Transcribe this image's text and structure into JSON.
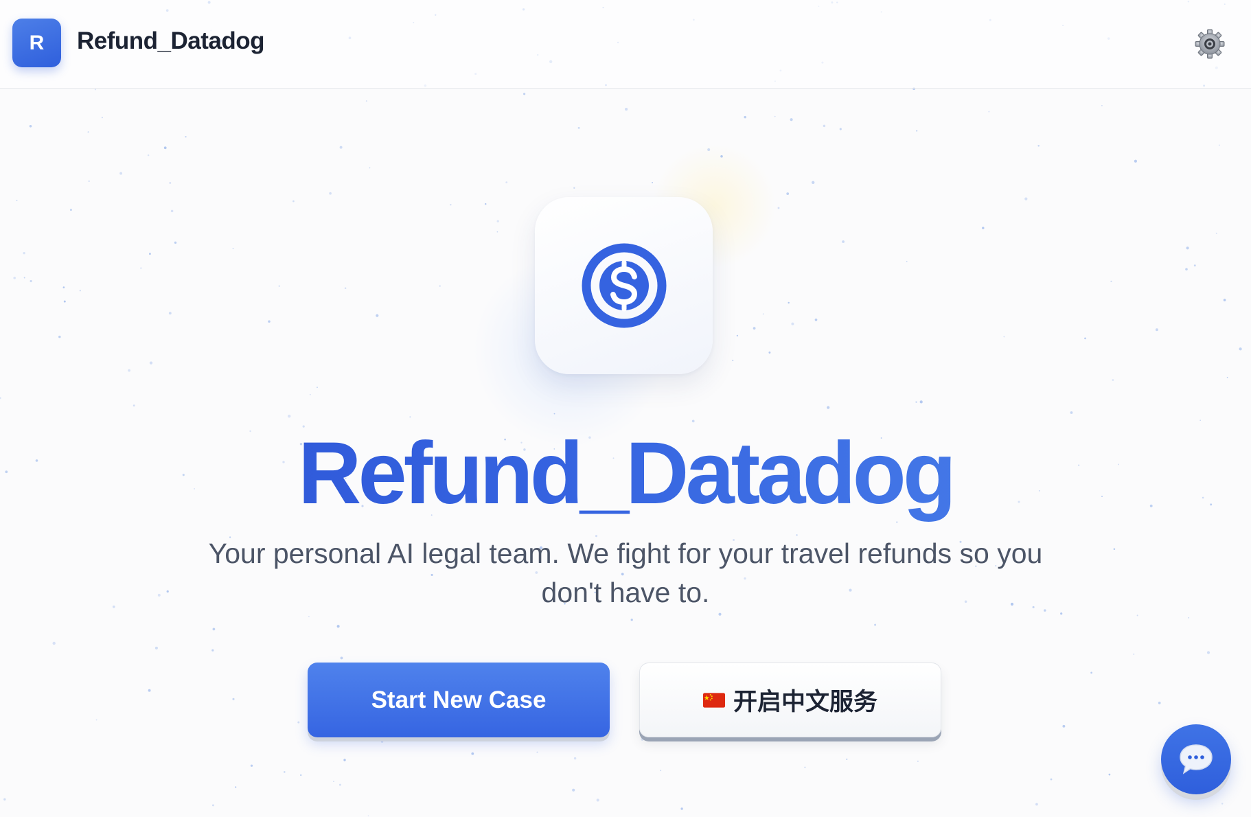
{
  "header": {
    "logo_letter": "R",
    "brand_name": "Refund_Datadog",
    "settings_icon": "gear-icon"
  },
  "hero": {
    "icon": "dollar-circle-icon",
    "title": "Refund_Datadog",
    "subtitle": "Your personal AI legal team. We fight for your travel refunds so you don't have to."
  },
  "actions": {
    "primary_label": "Start New Case",
    "secondary_label": "开启中文服务",
    "secondary_icon": "china-flag-icon"
  },
  "chat": {
    "icon": "chat-bubble-icon"
  },
  "colors": {
    "brand": "#3563e0",
    "brand_light": "#4e86ec",
    "text_dark": "#1c2333",
    "text_muted": "#4c5567",
    "background": "#fbfbfc"
  }
}
